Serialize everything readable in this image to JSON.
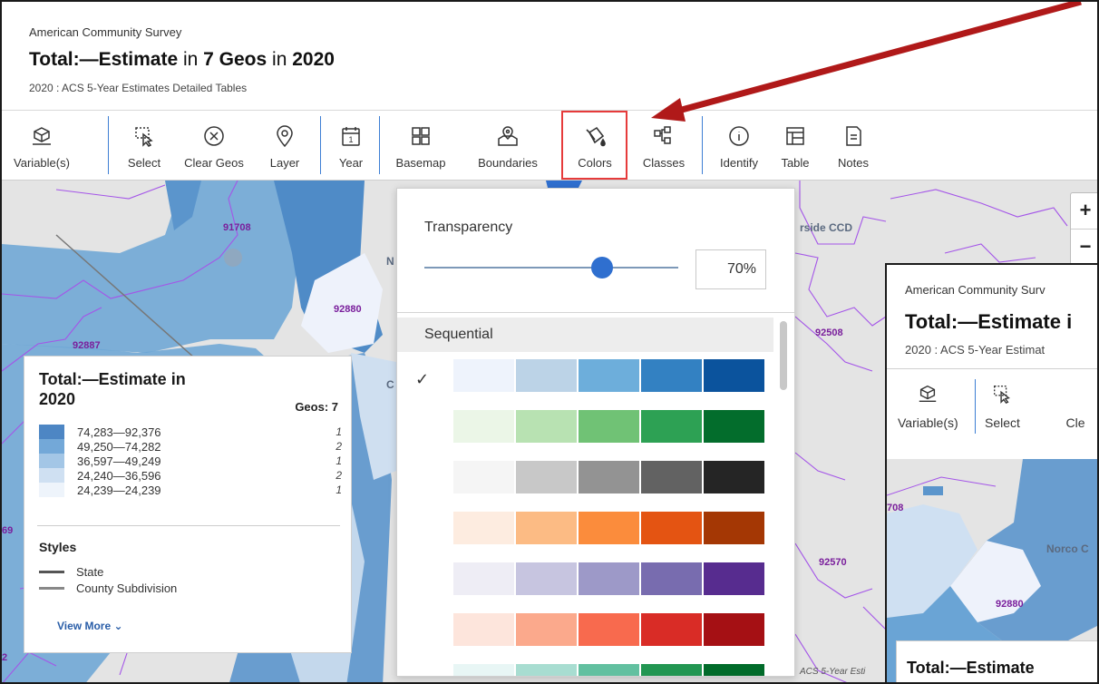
{
  "header": {
    "survey": "American Community Survey",
    "title_part1": "Total:—Estimate",
    "title_in1": " in ",
    "title_part2": "7 Geos",
    "title_in2": " in ",
    "title_part3": "2020",
    "subtitle": "2020 : ACS 5-Year Estimates Detailed Tables"
  },
  "toolbar": {
    "variables": "Variable(s)",
    "select": "Select",
    "clear_geos": "Clear Geos",
    "layer": "Layer",
    "year": "Year",
    "basemap": "Basemap",
    "boundaries": "Boundaries",
    "colors": "Colors",
    "classes": "Classes",
    "identify": "Identify",
    "table": "Table",
    "notes": "Notes",
    "year_badge": "1"
  },
  "map": {
    "labels": [
      "91708",
      "92880",
      "92887",
      "92508",
      "92570",
      "Norco C",
      "rside CCD",
      "N",
      "C",
      "69",
      "708",
      "2"
    ],
    "attribution": "ACS 5-Year Esti",
    "zoom_in": "+",
    "zoom_out": "−"
  },
  "legend": {
    "title": "Total:—Estimate in 2020",
    "geos": "Geos: 7",
    "rows": [
      {
        "range": "74,283—92,376",
        "count": "1",
        "color": "#4d86c4"
      },
      {
        "range": "49,250—74,282",
        "count": "2",
        "color": "#73a8d8"
      },
      {
        "range": "36,597—49,249",
        "count": "1",
        "color": "#a3c6e6"
      },
      {
        "range": "24,240—36,596",
        "count": "2",
        "color": "#cfe0f2"
      },
      {
        "range": "24,239—24,239",
        "count": "1",
        "color": "#eef4fb"
      }
    ],
    "styles_label": "Styles",
    "style_state": "State",
    "style_county": "County Subdivision",
    "view_more": "View More ⌄"
  },
  "colors_panel": {
    "transparency_label": "Transparency",
    "transparency_value": "70%",
    "transparency_level": 0.7,
    "section": "Sequential",
    "check": "✓",
    "palettes": [
      [
        "#eef3fc",
        "#bcd3e7",
        "#6daedb",
        "#3381c2",
        "#0b539d"
      ],
      [
        "#ebf6e7",
        "#b8e2b2",
        "#70c275",
        "#2da154",
        "#036d2c"
      ],
      [
        "#f5f5f5",
        "#c8c8c8",
        "#939393",
        "#626262",
        "#252525"
      ],
      [
        "#fdece0",
        "#fcbb84",
        "#fb8c3c",
        "#e45412",
        "#a43704"
      ],
      [
        "#eeedf5",
        "#c7c5e0",
        "#9d99c8",
        "#786caf",
        "#572c8f"
      ],
      [
        "#fde5dc",
        "#fba98c",
        "#f86a4e",
        "#d92c26",
        "#a51014"
      ],
      [
        "#e8f6f5",
        "#a8ddd1",
        "#62c0a0",
        "#229652",
        "#016b2a"
      ]
    ]
  },
  "overlay": {
    "survey": "American Community Surv",
    "title": "Total:—Estimate i",
    "subtitle": "2020 : ACS 5-Year Estimat",
    "variables": "Variable(s)",
    "select": "Select",
    "clear": "Cle",
    "legend_title": "Total:—Estimate",
    "map_labels": [
      "708",
      "Norco C",
      "92570",
      "92880"
    ]
  }
}
